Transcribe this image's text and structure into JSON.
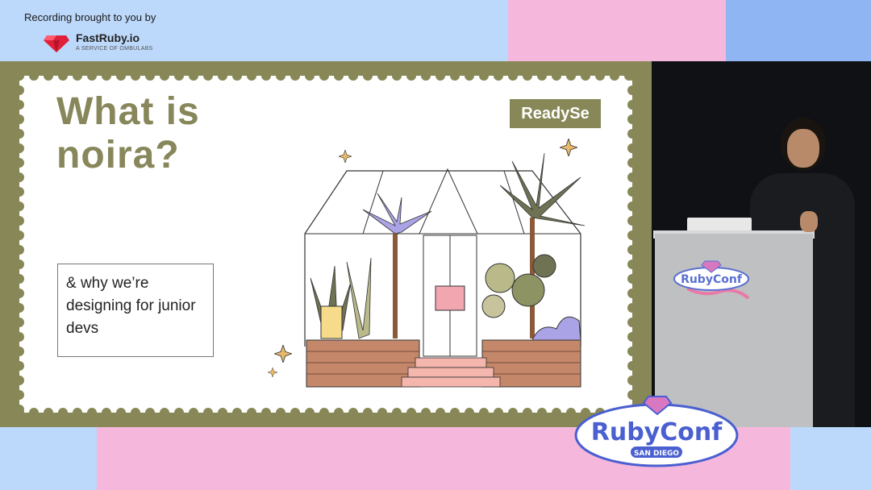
{
  "sponsor": {
    "intro": "Recording brought to you by",
    "brand": "FastRuby.io",
    "tagline": "A SERVICE OF OMBULABS"
  },
  "slide": {
    "title_line1": "What is",
    "title_line2": "noira?",
    "subtitle": "& why we’re designing for junior devs",
    "tag": "ReadySe"
  },
  "event": {
    "logo_text": "RubyConf",
    "logo_sub": "SAN DIEGO"
  },
  "colors": {
    "olive": "#878758",
    "pink": "#f6b7dd",
    "blue": "#bcd8fa",
    "ruby": "#e0203a"
  },
  "icons": [
    "ruby-gem-icon",
    "greenhouse-illustration",
    "sparkle-icon",
    "rubyconf-logo"
  ]
}
